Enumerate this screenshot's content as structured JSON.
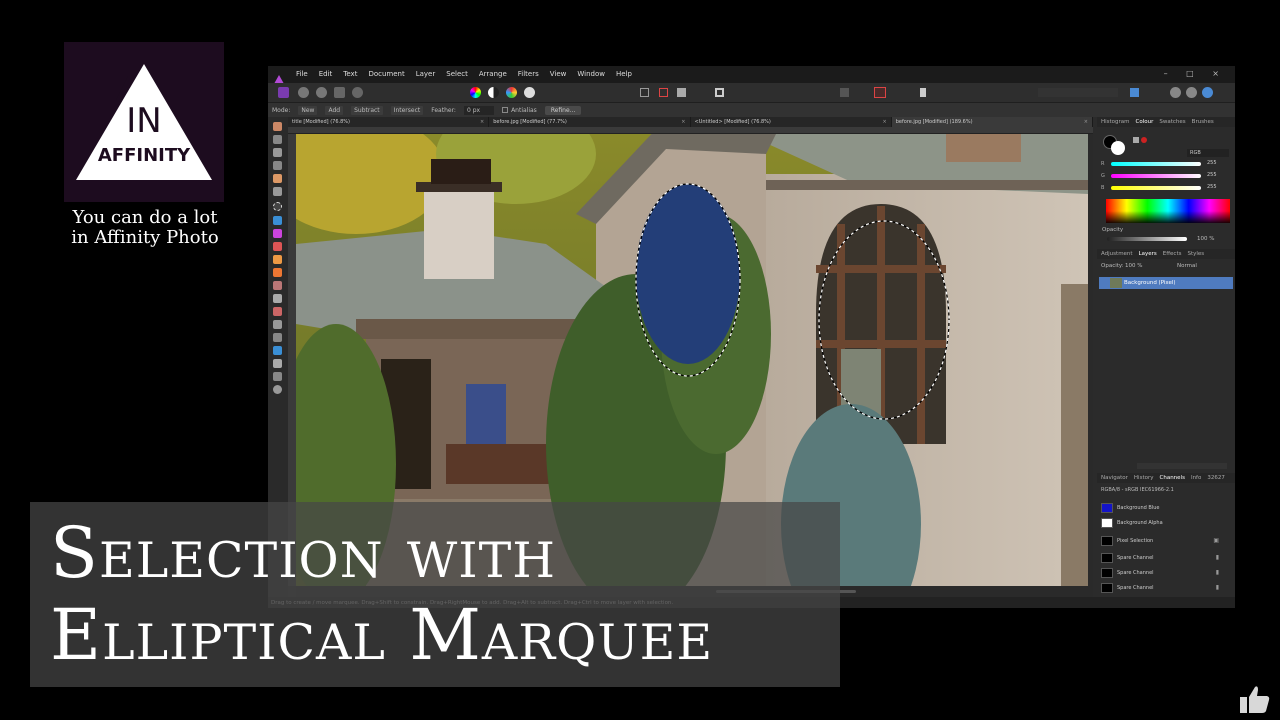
{
  "logo": {
    "line1": "IN",
    "line2": "AFFINITY"
  },
  "tagline": {
    "line1": "You can do a lot",
    "line2": "in Affinity Photo"
  },
  "menu": [
    "File",
    "Edit",
    "Text",
    "Document",
    "Layer",
    "Select",
    "Arrange",
    "Filters",
    "View",
    "Window",
    "Help"
  ],
  "window_controls": "– □ ×",
  "context_bar": {
    "mode_label": "Mode:",
    "modes": [
      "New",
      "Add",
      "Subtract",
      "Intersect"
    ],
    "feather_label": "Feather:",
    "feather_value": "0 px",
    "antialias_label": "Antialias",
    "refine_label": "Refine..."
  },
  "tabs": [
    {
      "label": "title [Modified] (76.8%)"
    },
    {
      "label": "before.jpg [Modified] (77.7%)"
    },
    {
      "label": "<Untitled> [Modified] (76.8%)"
    },
    {
      "label": "before.jpg [Modified] (189.6%)"
    }
  ],
  "status_bar": "Drag to create / move marquee. Drag+Shift to constrain. Drag+RightMouse to add. Drag+Alt to subtract. Drag+Ctrl to move layer with selection.",
  "colour_panel": {
    "tabs": [
      "Histogram",
      "Colour",
      "Swatches",
      "Brushes"
    ],
    "active": "Colour",
    "mode": "RGB",
    "channels": [
      {
        "label": "R",
        "value": "255"
      },
      {
        "label": "G",
        "value": "255"
      },
      {
        "label": "B",
        "value": "255"
      }
    ],
    "opacity_label": "Opacity",
    "opacity_value": "100 %"
  },
  "layers_panel": {
    "tabs": [
      "Adjustment",
      "Layers",
      "Effects",
      "Styles"
    ],
    "active": "Layers",
    "opacity_label": "Opacity:",
    "opacity_value": "100 %",
    "blend_mode": "Normal",
    "layer_name": "Background (Pixel)"
  },
  "channels_panel": {
    "tabs": [
      "Navigator",
      "History",
      "Channels",
      "Info",
      "32627"
    ],
    "active": "Channels",
    "format": "RGBA/8 - sRGB IEC61966-2.1",
    "channels": [
      "Background Blue",
      "Background Alpha"
    ],
    "pixel_selection": "Pixel Selection",
    "spare": [
      "Spare Channel",
      "Spare Channel",
      "Spare Channel"
    ]
  },
  "title": {
    "line1": "Selection with",
    "line2": "Elliptical Marquee"
  },
  "colors": {
    "accent": "#4f7bbf",
    "affinity_purple": "#1d0c1f"
  }
}
